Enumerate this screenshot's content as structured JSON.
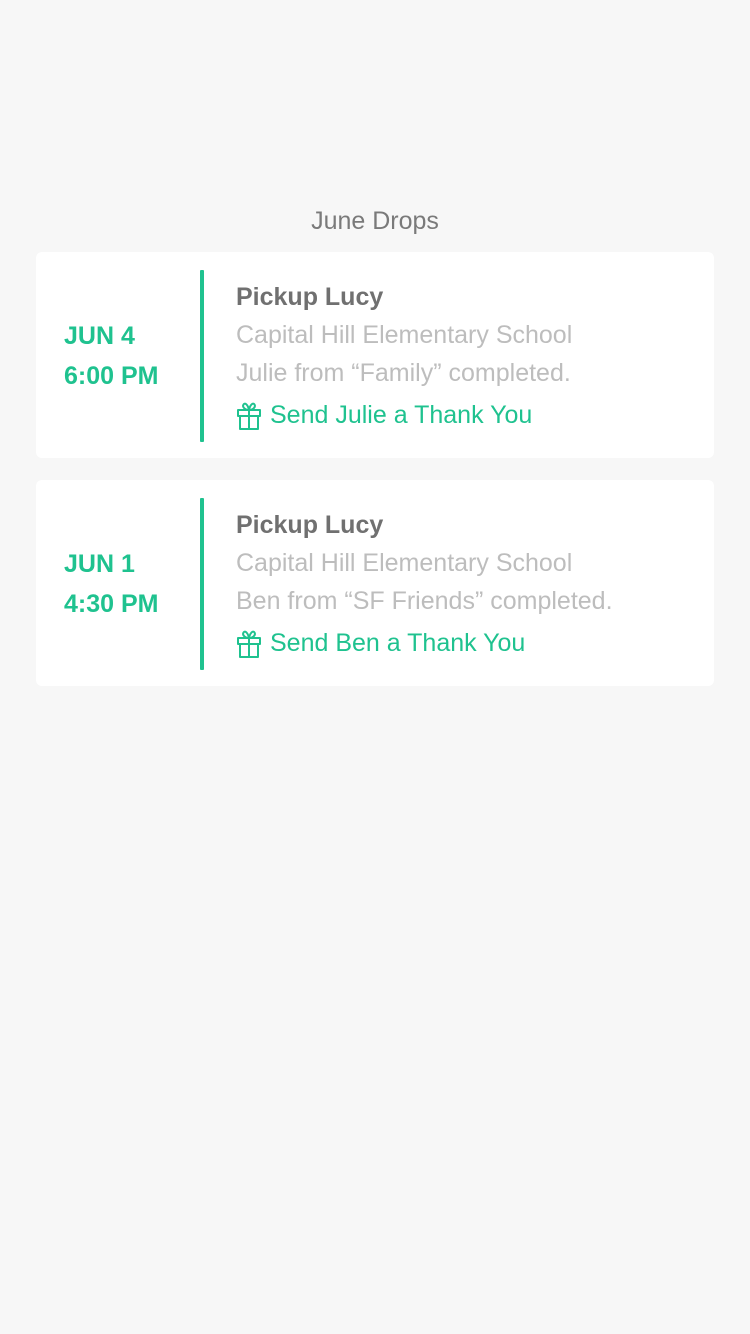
{
  "header": {
    "title": "June Drops"
  },
  "drops": [
    {
      "date": "JUN 4",
      "time": "6:00 PM",
      "title": "Pickup Lucy",
      "place": "Capital Hill Elementary School",
      "status": "Julie from “Family” completed.",
      "action_label": "Send Julie a Thank You",
      "action_icon": "gift-icon"
    },
    {
      "date": "JUN 1",
      "time": "4:30 PM",
      "title": "Pickup Lucy",
      "place": "Capital Hill Elementary School",
      "status": "Ben from “SF Friends” completed.",
      "action_label": "Send Ben a Thank You",
      "action_icon": "gift-icon"
    }
  ],
  "colors": {
    "accent": "#1fc28f",
    "background": "#f7f7f7",
    "card": "#ffffff",
    "title_text": "#707070",
    "muted_text": "#bdbdbd"
  }
}
